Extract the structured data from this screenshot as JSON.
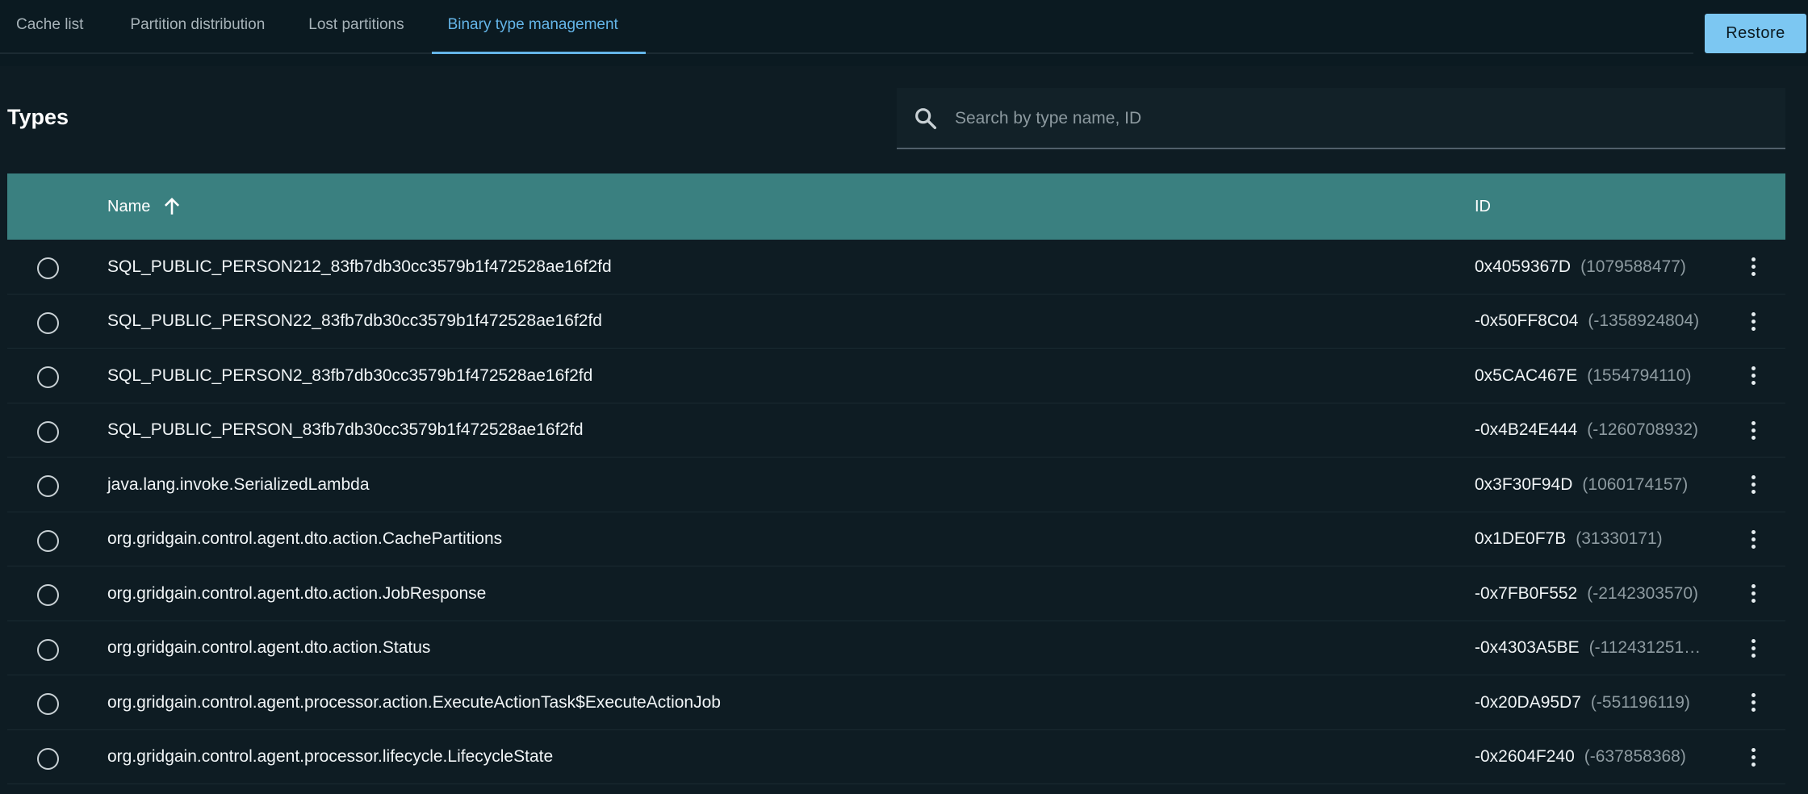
{
  "tabs": [
    {
      "label": "Cache list",
      "active": false
    },
    {
      "label": "Partition distribution",
      "active": false
    },
    {
      "label": "Lost partitions",
      "active": false
    },
    {
      "label": "Binary type management",
      "active": true
    }
  ],
  "restore_label": "Restore",
  "section_title": "Types",
  "search": {
    "placeholder": "Search by type name, ID",
    "value": "",
    "icon": "search-icon"
  },
  "table": {
    "columns": {
      "name": "Name",
      "id": "ID"
    },
    "sort": {
      "column": "Name",
      "direction": "ascending",
      "icon": "arrow-up-icon"
    },
    "rows": [
      {
        "name": "SQL_PUBLIC_PERSON212_83fb7db30cc3579b1f472528ae16f2fd",
        "hex": "0x4059367D",
        "dec": "(1079588477)"
      },
      {
        "name": "SQL_PUBLIC_PERSON22_83fb7db30cc3579b1f472528ae16f2fd",
        "hex": "-0x50FF8C04",
        "dec": "(-1358924804)"
      },
      {
        "name": "SQL_PUBLIC_PERSON2_83fb7db30cc3579b1f472528ae16f2fd",
        "hex": "0x5CAC467E",
        "dec": "(1554794110)"
      },
      {
        "name": "SQL_PUBLIC_PERSON_83fb7db30cc3579b1f472528ae16f2fd",
        "hex": "-0x4B24E444",
        "dec": "(-1260708932)"
      },
      {
        "name": "java.lang.invoke.SerializedLambda",
        "hex": "0x3F30F94D",
        "dec": "(1060174157)"
      },
      {
        "name": "org.gridgain.control.agent.dto.action.CachePartitions",
        "hex": "0x1DE0F7B",
        "dec": "(31330171)"
      },
      {
        "name": "org.gridgain.control.agent.dto.action.JobResponse",
        "hex": "-0x7FB0F552",
        "dec": "(-2142303570)"
      },
      {
        "name": "org.gridgain.control.agent.dto.action.Status",
        "hex": "-0x4303A5BE",
        "dec": "(-112431251…"
      },
      {
        "name": "org.gridgain.control.agent.processor.action.ExecuteActionTask$ExecuteActionJob",
        "hex": "-0x20DA95D7",
        "dec": "(-551196119)"
      },
      {
        "name": "org.gridgain.control.agent.processor.lifecycle.LifecycleState",
        "hex": "-0x2604F240",
        "dec": "(-637858368)"
      }
    ]
  }
}
